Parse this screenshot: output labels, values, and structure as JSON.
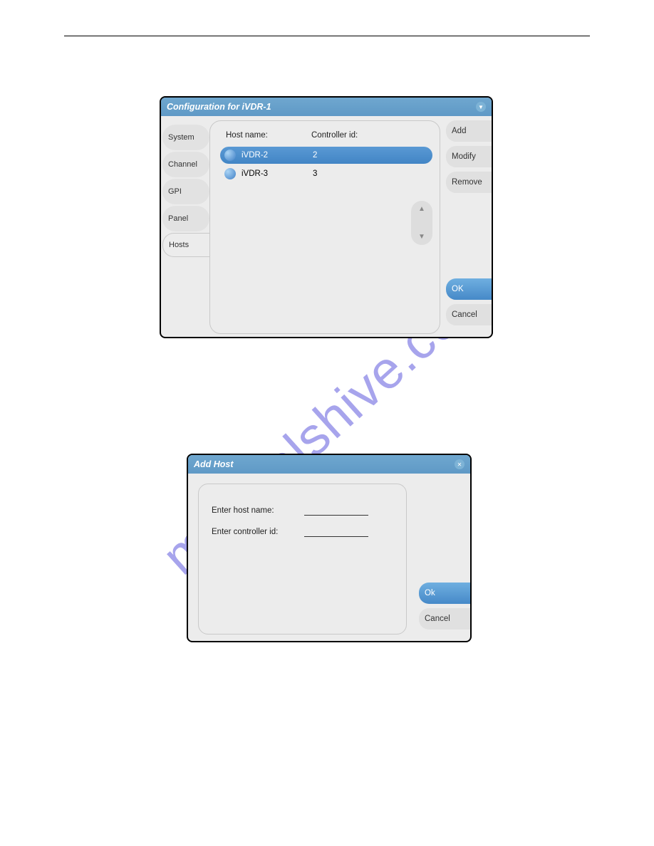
{
  "watermark": "manualshive.com",
  "dialog1": {
    "title": "Configuration for iVDR-1",
    "tabs": [
      "System",
      "Channel",
      "GPI",
      "Panel",
      "Hosts"
    ],
    "activeTab": "Hosts",
    "columns": {
      "host": "Host name:",
      "controller": "Controller id:"
    },
    "rows": [
      {
        "name": "iVDR-2",
        "id": "2",
        "selected": true
      },
      {
        "name": "iVDR-3",
        "id": "3",
        "selected": false
      }
    ],
    "buttons": {
      "add": "Add",
      "modify": "Modify",
      "remove": "Remove",
      "ok": "OK",
      "cancel": "Cancel"
    }
  },
  "dialog2": {
    "title": "Add Host",
    "fields": {
      "hostLabel": "Enter host name:",
      "controllerLabel": "Enter controller id:",
      "hostValue": "",
      "controllerValue": ""
    },
    "buttons": {
      "ok": "Ok",
      "cancel": "Cancel"
    }
  }
}
